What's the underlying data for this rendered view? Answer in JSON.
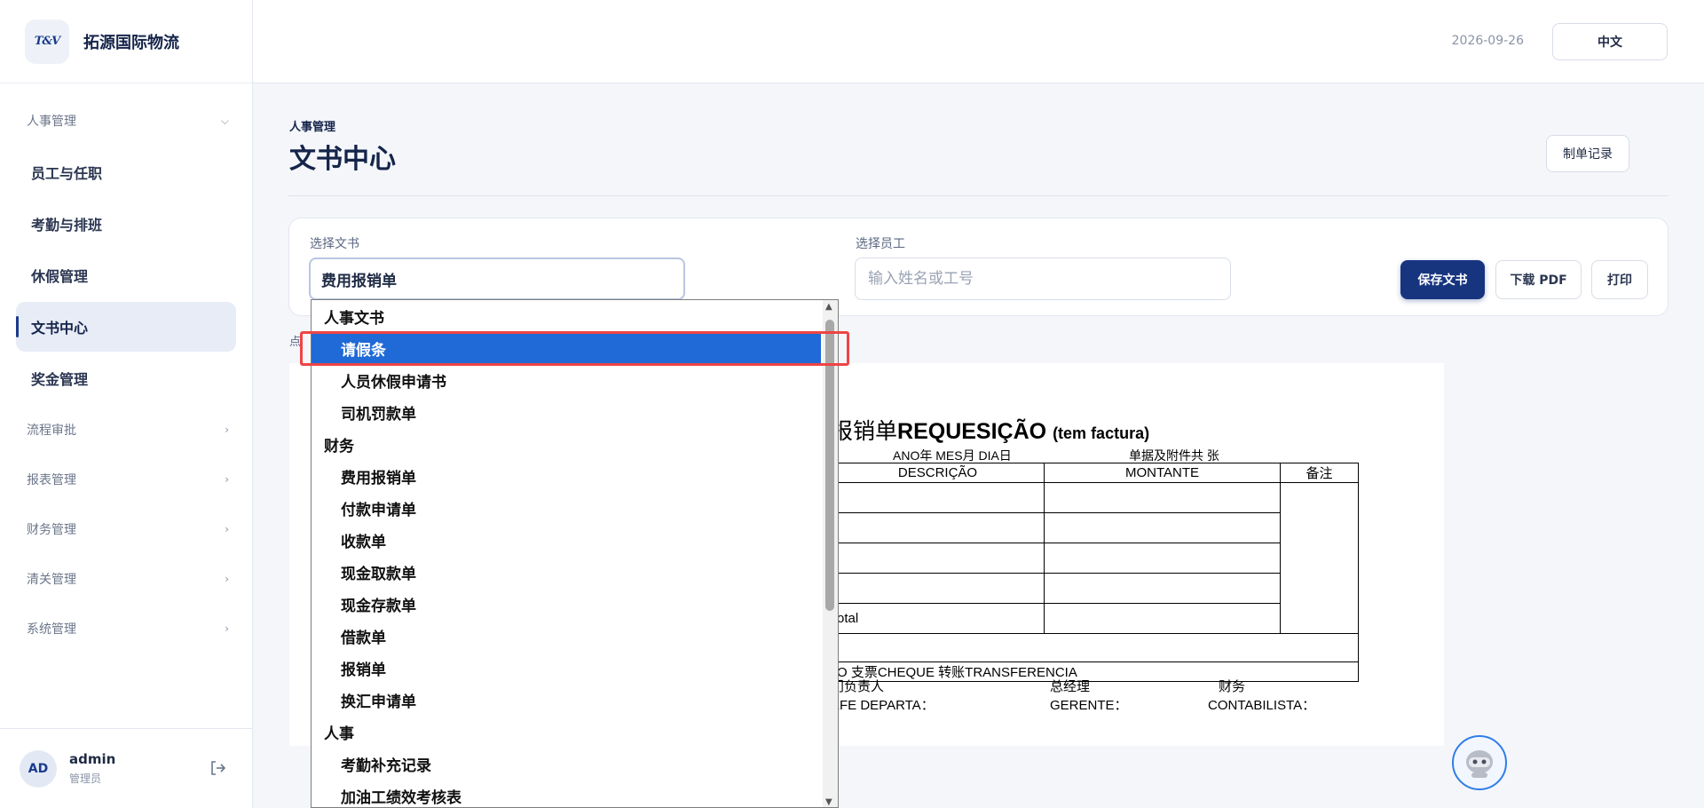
{
  "brand": {
    "name": "拓源国际物流",
    "logo_text": "T&V"
  },
  "sidebar": {
    "groups": [
      {
        "label": "人事管理",
        "expanded": true
      },
      {
        "label": "流程审批"
      },
      {
        "label": "报表管理"
      },
      {
        "label": "财务管理"
      },
      {
        "label": "清关管理"
      },
      {
        "label": "系统管理"
      }
    ],
    "items": [
      {
        "label": "员工与任职"
      },
      {
        "label": "考勤与排班"
      },
      {
        "label": "休假管理"
      },
      {
        "label": "文书中心",
        "active": true
      },
      {
        "label": "奖金管理"
      }
    ]
  },
  "user": {
    "initials": "AD",
    "name": "admin",
    "role": "管理员"
  },
  "topbar": {
    "date": "2026-09-26",
    "language": "中文"
  },
  "page": {
    "breadcrumb": "人事管理",
    "title": "文书中心",
    "record_button": "制单记录"
  },
  "form": {
    "doc_label": "选择文书",
    "doc_value": "费用报销单",
    "emp_label": "选择员工",
    "emp_placeholder": "输入姓名或工号",
    "save_button": "保存文书",
    "pdf_button": "下载 PDF",
    "print_button": "打印"
  },
  "hint_text": "点",
  "dropdown": {
    "groups": [
      {
        "label": "人事文书",
        "options": [
          "请假条",
          "人员休假申请书",
          "司机罚款单"
        ]
      },
      {
        "label": "财务",
        "options": [
          "费用报销单",
          "付款申请单",
          "收款单",
          "现金取款单",
          "现金存款单",
          "借款单",
          "报销单",
          "换汇申请单"
        ]
      },
      {
        "label": "人事",
        "options": [
          "考勤补充记录",
          "加油工绩效考核表"
        ]
      }
    ],
    "selected": "请假条"
  },
  "document": {
    "title_cn": "报销单",
    "title_pt": "REQUESIÇÃO",
    "title_note": "(tem factura)",
    "date_line": "ANO年   MES月    DIA日",
    "attach_line": "单据及附件共  张",
    "col_desc": "DESCRIÇÃO",
    "col_amount": "MONTANTE",
    "col_note": "备注",
    "total_label": "otal",
    "payment_line": "O     支票CHEQUE      转账TRANSFERENCIA",
    "sign_cn": [
      "门负责人",
      "总经理",
      "财务"
    ],
    "sign_pt": [
      "EFE DEPARTA：",
      "GERENTE：",
      "CONTABILISTA："
    ]
  },
  "colors": {
    "primary": "#17357f",
    "selection": "#1f6ad6",
    "highlight": "#ef4444"
  }
}
